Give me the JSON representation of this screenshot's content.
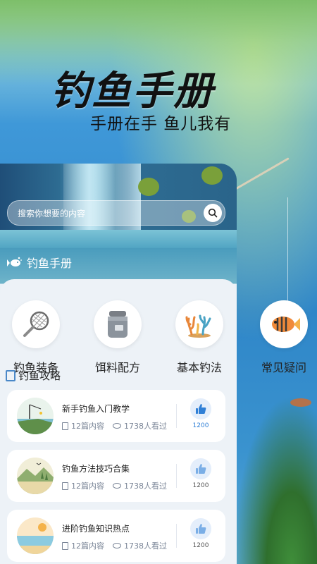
{
  "hero": {
    "title": "钓鱼手册",
    "subtitle": "手册在手  鱼儿我有"
  },
  "search": {
    "placeholder": "搜索你想要的内容"
  },
  "section": {
    "title": "钓鱼手册"
  },
  "categories": [
    {
      "label": "钓鱼装备",
      "icon": "fishing-net-icon"
    },
    {
      "label": "饵料配方",
      "icon": "bait-jar-icon"
    },
    {
      "label": "基本钓法",
      "icon": "coral-icon"
    },
    {
      "label": "常见疑问",
      "icon": "fish-icon"
    }
  ],
  "guide": {
    "title": "钓鱼攻略",
    "items": [
      {
        "title": "新手钓鱼入门教学",
        "count": "12篇内容",
        "views": "1738人看过",
        "likes": "1200"
      },
      {
        "title": "钓鱼方法技巧合集",
        "count": "12篇内容",
        "views": "1738人看过",
        "likes": "1200"
      },
      {
        "title": "进阶钓鱼知识热点",
        "count": "12篇内容",
        "views": "1738人看过",
        "likes": "1200"
      }
    ]
  },
  "colors": {
    "accent": "#2f7fd6",
    "panel_bg": "#edf2f7"
  }
}
